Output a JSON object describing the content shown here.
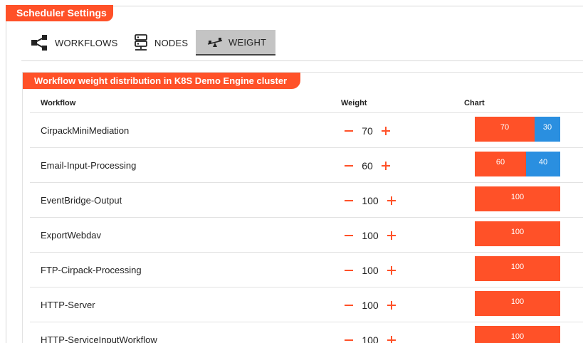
{
  "header": {
    "title": "Scheduler Settings"
  },
  "tabs": [
    {
      "label": "WORKFLOWS",
      "icon": "workflow-icon",
      "active": false
    },
    {
      "label": "NODES",
      "icon": "server-icon",
      "active": false
    },
    {
      "label": "WEIGHT",
      "icon": "seesaw-icon",
      "active": true
    }
  ],
  "section": {
    "title": "Workflow weight distribution in K8S Demo Engine cluster"
  },
  "table": {
    "columns": [
      "Workflow",
      "Weight",
      "Chart"
    ],
    "rows": [
      {
        "name": "CirpackMiniMediation",
        "weight": "70",
        "segments": [
          "70",
          "30"
        ]
      },
      {
        "name": "Email-Input-Processing",
        "weight": "60",
        "segments": [
          "60",
          "40"
        ]
      },
      {
        "name": "EventBridge-Output",
        "weight": "100",
        "segments": [
          "100"
        ]
      },
      {
        "name": "ExportWebdav",
        "weight": "100",
        "segments": [
          "100"
        ]
      },
      {
        "name": "FTP-Cirpack-Processing",
        "weight": "100",
        "segments": [
          "100"
        ]
      },
      {
        "name": "HTTP-Server",
        "weight": "100",
        "segments": [
          "100"
        ]
      },
      {
        "name": "HTTP-ServiceInputWorkflow",
        "weight": "100",
        "segments": [
          "100"
        ]
      }
    ]
  },
  "colors": {
    "accent": "#ff5128",
    "secondary": "#2a8fe0",
    "active_tab": "#c4c4c4"
  }
}
